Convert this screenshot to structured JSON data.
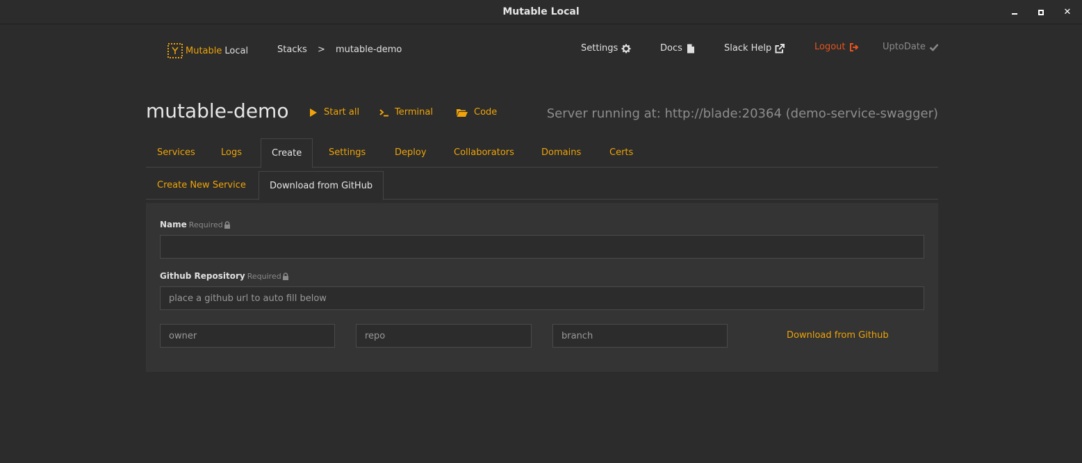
{
  "window": {
    "title": "Mutable Local"
  },
  "nav": {
    "brand_mutable": "Mutable",
    "brand_local": "Local",
    "crumb_stacks": "Stacks",
    "crumb_sep": ">",
    "crumb_current": "mutable-demo",
    "settings": "Settings",
    "docs": "Docs",
    "slack_help": "Slack Help",
    "logout": "Logout",
    "uptodate": "UptoDate"
  },
  "header": {
    "title": "mutable-demo",
    "start_all": "Start all",
    "terminal": "Terminal",
    "code": "Code",
    "server": "Server running at: http://blade:20364 (demo-service-swagger)"
  },
  "tabs": [
    "Services",
    "Logs",
    "Create",
    "Settings",
    "Deploy",
    "Collaborators",
    "Domains",
    "Certs"
  ],
  "active_tab": "Create",
  "subtabs": [
    "Create New Service",
    "Download from GitHub"
  ],
  "active_subtab": "Download from GitHub",
  "form": {
    "name_label": "Name",
    "name_required": "Required",
    "name_value": "",
    "repo_label": "Github Repository",
    "repo_required": "Required",
    "repo_placeholder": "place a github url to auto fill below",
    "owner_placeholder": "owner",
    "repo_name_placeholder": "repo",
    "branch_placeholder": "branch",
    "download_link": "Download from Github"
  },
  "colors": {
    "accent": "#f0a30a",
    "logout": "#e8531f",
    "background": "#2b2c2b",
    "panel": "#333433"
  }
}
